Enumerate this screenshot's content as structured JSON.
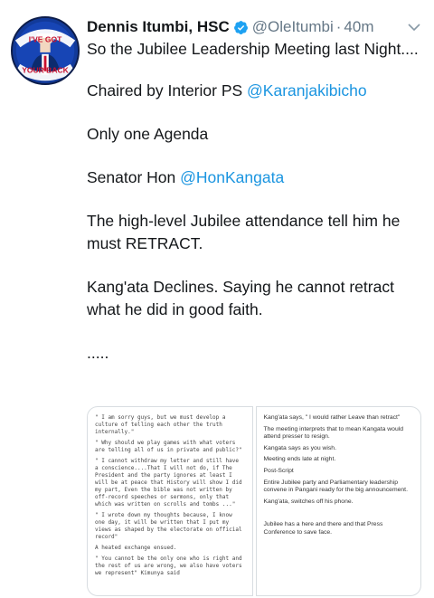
{
  "author": {
    "name": "Dennis Itumbi, HSC",
    "handle": "@OleItumbi",
    "separator": "·",
    "time": "40m",
    "avatar_text": "I'VE GOT YOUR BACK",
    "badge_icon": "verified-icon"
  },
  "tweet": {
    "line1": "So the Jubilee Leadership Meeting last Night....",
    "chair_prefix": "Chaired by Interior PS ",
    "chair_mention": "@Karanjakibicho",
    "agenda": "Only one Agenda",
    "senator_prefix": "Senator Hon ",
    "senator_mention": "@HonKangata",
    "attendance": "The high-level Jubilee attendance tell him he must RETRACT.",
    "declines": "Kang'ata Declines. Saying he cannot retract what he did in good faith.",
    "ellipsis": "....."
  },
  "media": {
    "left_lines": [
      "\" I am sorry guys, but we must develop a culture of telling each other the truth internally.\"",
      "\" Why should we play games with what voters are telling all of us in private and public?\"",
      "\" I cannot withdraw my letter and still have a conscience....That I will not do, if The President and the party ignores at least I will be at peace that History will show I did my part, Even the bible was not written by off-record speeches or sermons, only that which was written on scrolls and tombs ...\"",
      "\" I wrote down my thoughts because, I know one day, it will be written that I put my views as shaped by the electorate on official record\"",
      "A heated exchange ensued.",
      "\" You cannot be the only one who is right and the rest of us are wrong, we also have voters we represent\" Kimunya said"
    ],
    "right_lines": [
      "Kang'ata says, \" I would rather Leave than retract\"",
      "The meeting interprets that to mean Kangata would attend presser to resign.",
      "Kangata says as you wish.",
      "Meeting ends late at night.",
      "Post-Script",
      "Entire Jubilee party and Parliamentary leadership convene in Pangani ready for the big announcement.",
      "Kang'ata, switches off his phone.",
      "",
      "Jubilee has a here and there and that Press Conference to save face."
    ]
  },
  "colors": {
    "link": "#1b95e0",
    "muted": "#657786",
    "text": "#14171a"
  }
}
